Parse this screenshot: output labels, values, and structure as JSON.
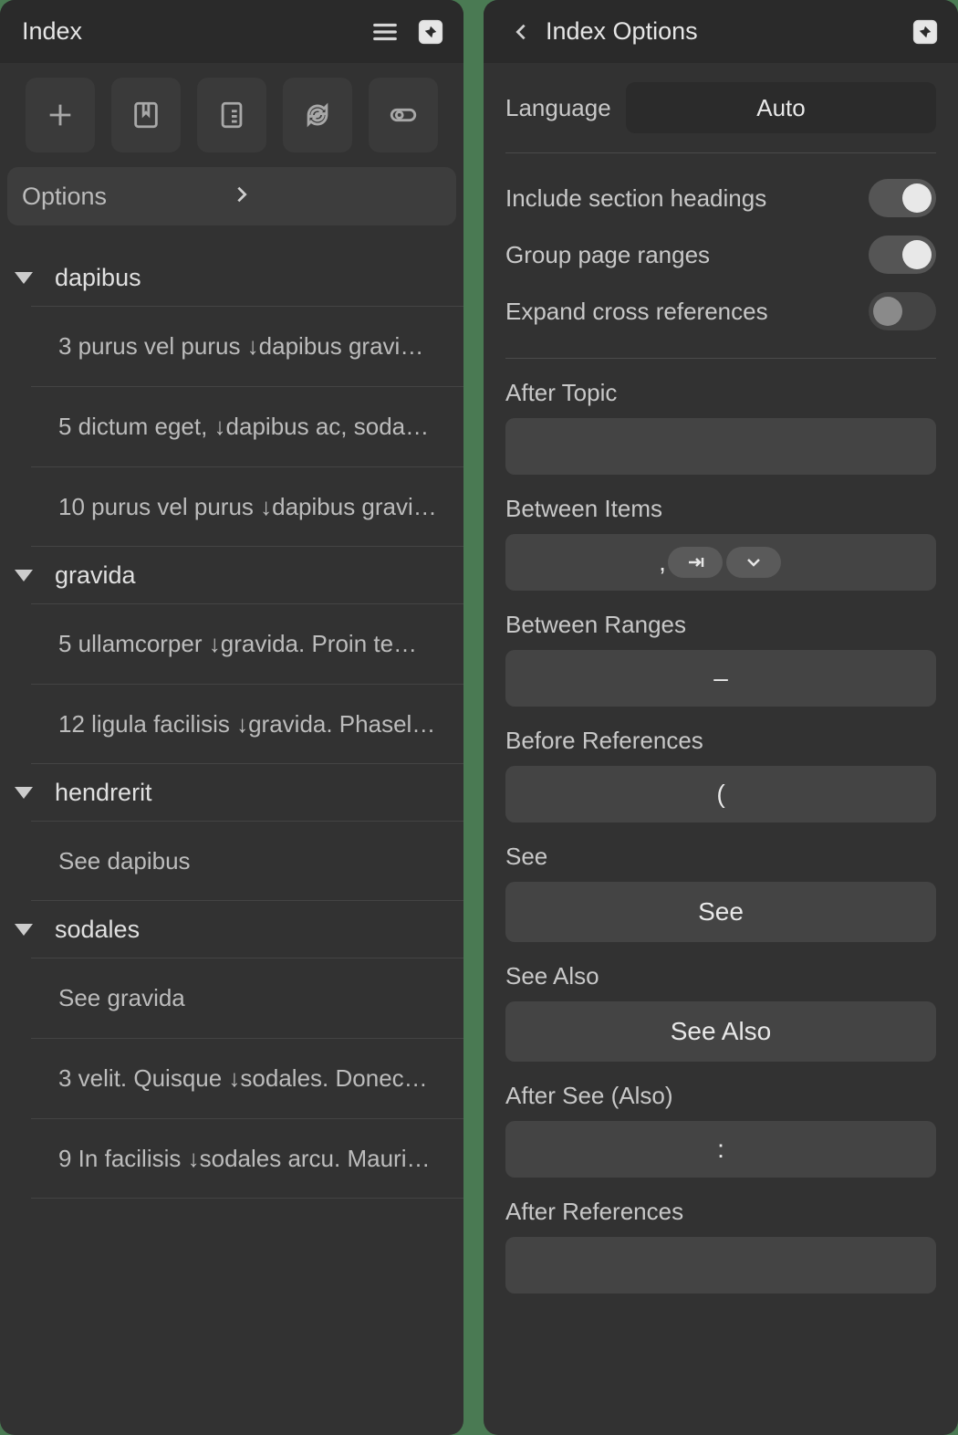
{
  "left": {
    "title": "Index",
    "options_label": "Options",
    "groups": [
      {
        "name": "dapibus",
        "entries": [
          "3 purus vel purus ↓dapibus gravi…",
          "5 dictum eget, ↓dapibus ac, soda…",
          "10 purus vel purus ↓dapibus gravi…"
        ]
      },
      {
        "name": "gravida",
        "entries": [
          "5 ullamcorper ↓gravida. Proin te…",
          "12 ligula facilisis ↓gravida. Phasel…"
        ]
      },
      {
        "name": "hendrerit",
        "entries": [
          "See dapibus"
        ]
      },
      {
        "name": "sodales",
        "entries": [
          "See gravida",
          "3 velit. Quisque ↓sodales. Donec…",
          "9 In facilisis ↓sodales arcu. Mauri…"
        ]
      }
    ]
  },
  "right": {
    "title": "Index Options",
    "language_label": "Language",
    "language_value": "Auto",
    "toggles": {
      "include_headings": {
        "label": "Include section headings",
        "on": true
      },
      "group_ranges": {
        "label": "Group page ranges",
        "on": true
      },
      "expand_xrefs": {
        "label": "Expand cross references",
        "on": false
      }
    },
    "fields": {
      "after_topic": {
        "label": "After Topic",
        "value": ""
      },
      "between_items": {
        "label": "Between Items",
        "value": ", "
      },
      "between_ranges": {
        "label": "Between Ranges",
        "value": "–"
      },
      "before_refs": {
        "label": "Before References",
        "value": "("
      },
      "see": {
        "label": "See",
        "value": "See"
      },
      "see_also": {
        "label": "See Also",
        "value": "See Also"
      },
      "after_see": {
        "label": "After See (Also)",
        "value": ":"
      },
      "after_refs": {
        "label": "After References",
        "value": ""
      }
    }
  }
}
